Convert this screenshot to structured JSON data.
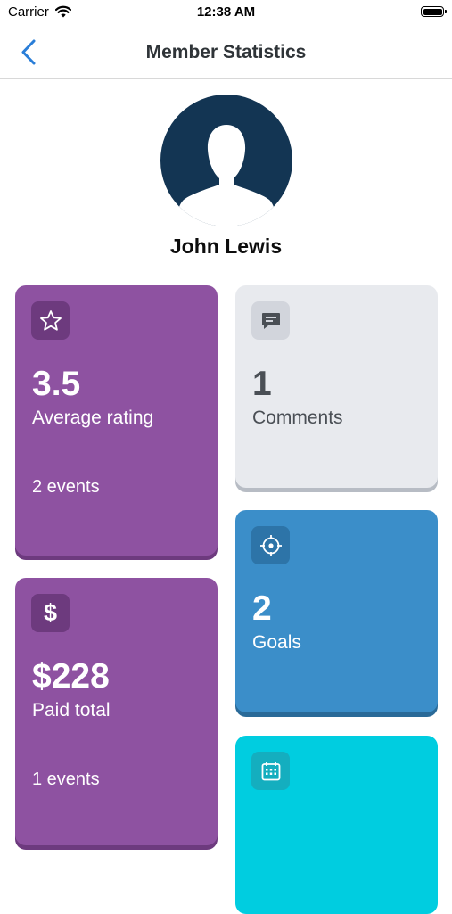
{
  "status_bar": {
    "carrier": "Carrier",
    "time": "12:38 AM"
  },
  "nav": {
    "title": "Member Statistics",
    "back_icon": "chevron-left-icon"
  },
  "profile": {
    "name": "John Lewis",
    "avatar_icon": "person-silhouette-icon",
    "avatar_color": "#133553"
  },
  "cards": {
    "rating": {
      "icon": "star-icon",
      "value": "3.5",
      "label": "Average rating",
      "sub": "2 events",
      "color": "#8e52a1"
    },
    "comments": {
      "icon": "comment-icon",
      "value": "1",
      "label": "Comments",
      "color": "#e8eaee"
    },
    "goals": {
      "icon": "target-icon",
      "value": "2",
      "label": "Goals",
      "color": "#3b8ec9"
    },
    "paid": {
      "icon": "dollar-icon",
      "value": "$228",
      "label": "Paid total",
      "sub": "1 events",
      "color": "#8e52a1"
    },
    "calendar": {
      "icon": "calendar-icon",
      "color": "#00cde0"
    }
  }
}
